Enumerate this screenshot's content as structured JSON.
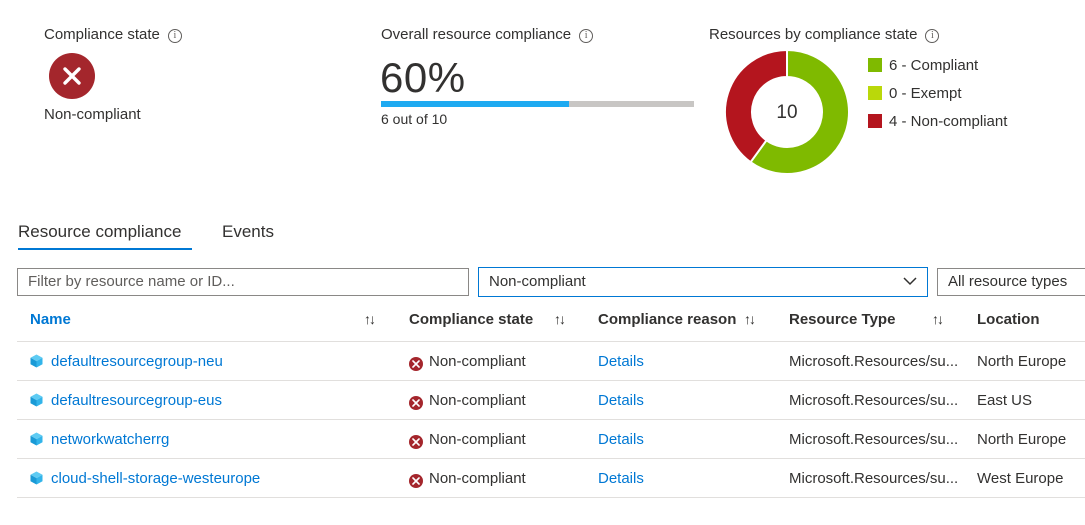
{
  "summary": {
    "compliance_state": {
      "title": "Compliance state",
      "info_icon": "info-icon",
      "icon": "error-circle-icon",
      "value": "Non-compliant"
    },
    "overall": {
      "title": "Overall resource compliance",
      "percent_text": "60%",
      "percent": 60,
      "subtitle": "6 out of 10"
    },
    "by_state": {
      "title": "Resources by compliance state",
      "total": "10",
      "legend": [
        {
          "label": "6 - Compliant",
          "color": "#7fba00",
          "count": 6
        },
        {
          "label": "0 - Exempt",
          "color": "#bad80a",
          "count": 0
        },
        {
          "label": "4 - Non-compliant",
          "color": "#b4151e",
          "count": 4
        }
      ]
    }
  },
  "tabs": [
    {
      "label": "Resource compliance",
      "active": true
    },
    {
      "label": "Events",
      "active": false
    }
  ],
  "filters": {
    "search_placeholder": "Filter by resource name or ID...",
    "state_value": "Non-compliant",
    "type_value": "All resource types"
  },
  "table": {
    "columns": [
      "Name",
      "Compliance state",
      "Compliance reason",
      "Resource Type",
      "Location"
    ],
    "rows": [
      {
        "name": "defaultresourcegroup-neu",
        "state": "Non-compliant",
        "reason": "Details",
        "type": "Microsoft.Resources/su...",
        "location": "North Europe"
      },
      {
        "name": "defaultresourcegroup-eus",
        "state": "Non-compliant",
        "reason": "Details",
        "type": "Microsoft.Resources/su...",
        "location": "East US"
      },
      {
        "name": "networkwatcherrg",
        "state": "Non-compliant",
        "reason": "Details",
        "type": "Microsoft.Resources/su...",
        "location": "North Europe"
      },
      {
        "name": "cloud-shell-storage-westeurope",
        "state": "Non-compliant",
        "reason": "Details",
        "type": "Microsoft.Resources/su...",
        "location": "West Europe"
      }
    ]
  },
  "colors": {
    "accent": "#0078d4",
    "error": "#a4262c",
    "progress": "#1eaaf1"
  }
}
